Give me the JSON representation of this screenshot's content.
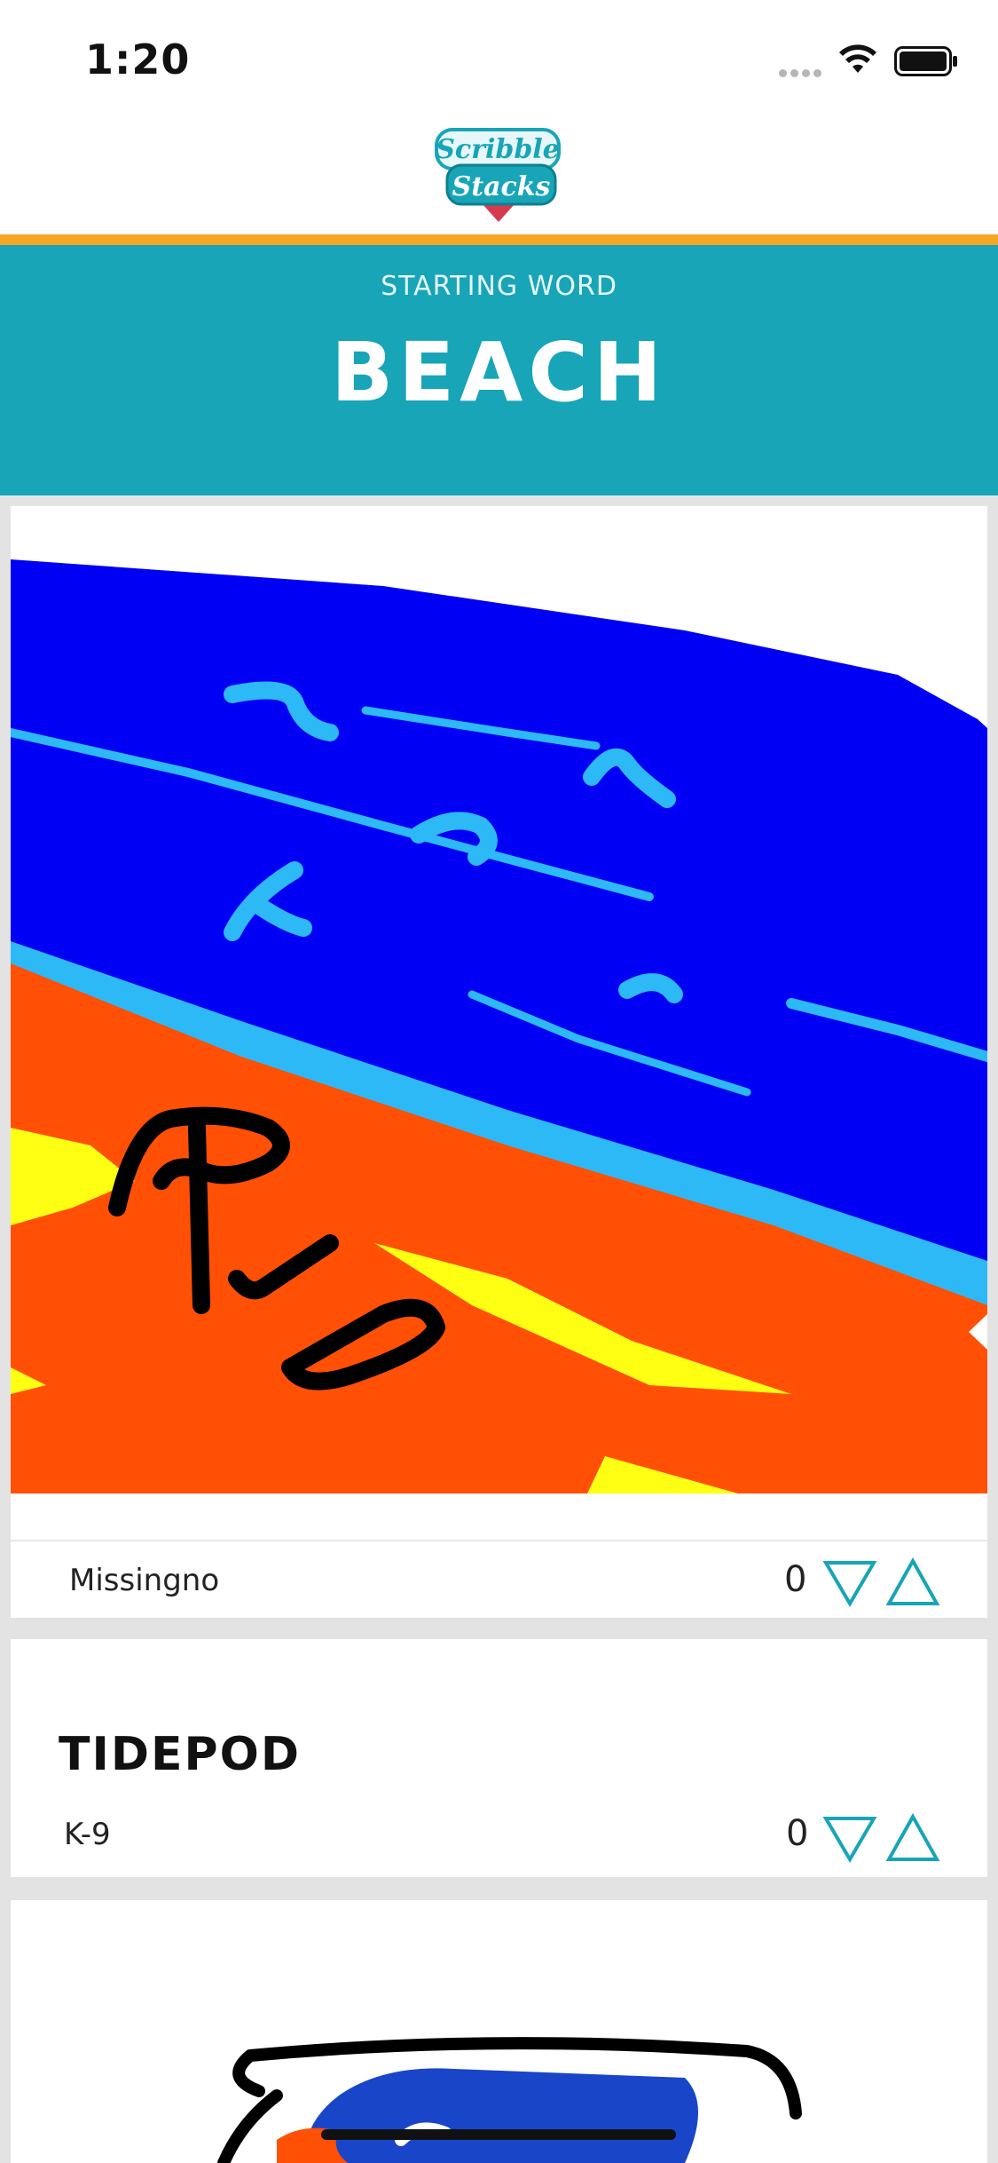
{
  "status_bar": {
    "time": "1:20"
  },
  "header": {
    "logo_text_line1": "Scribble",
    "logo_text_line2": "Stacks"
  },
  "banner": {
    "label": "STARTING WORD",
    "word": "BEACH"
  },
  "feed": [
    {
      "type": "drawing",
      "author": "Missingno",
      "score": "0"
    },
    {
      "type": "word",
      "word": "TIDEPOD",
      "author": "K-9",
      "score": "0"
    },
    {
      "type": "drawing"
    }
  ],
  "colors": {
    "accent_teal": "#17a5b7",
    "accent_orange": "#f5a623",
    "vote_arrow": "#17a5b7"
  },
  "icons": {
    "downvote": "triangle-down-outline",
    "upvote": "triangle-up-outline"
  }
}
